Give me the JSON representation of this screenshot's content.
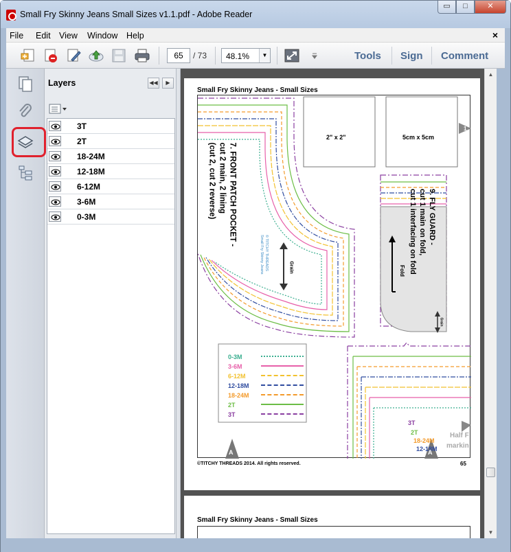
{
  "window": {
    "title": "Small Fry Skinny Jeans Small Sizes v1.1.pdf - Adobe Reader",
    "minimize": "▭",
    "maximize": "□",
    "close": "✕"
  },
  "menu": {
    "items": [
      "File",
      "Edit",
      "View",
      "Window",
      "Help"
    ],
    "close": "×"
  },
  "toolbar": {
    "page_number": "65",
    "page_total": "/ 73",
    "zoom": "48.1%",
    "zoom_arrow": "▼",
    "tools": "Tools",
    "sign": "Sign",
    "comment": "Comment",
    "icons": [
      "create-pdf-icon",
      "convert-pdf-icon",
      "edit-icon",
      "upload-icon",
      "save-icon",
      "print-icon",
      "fit-page-icon",
      "toolbar-options-icon"
    ]
  },
  "left_rail": {
    "icons": [
      "pages-icon",
      "attachments-icon",
      "layers-icon",
      "model-tree-icon"
    ],
    "active": "layers-icon",
    "highlight_color": "#e0212d"
  },
  "layers": {
    "title": "Layers",
    "collapse": "◀◀",
    "close": "▶",
    "items": [
      {
        "label": "3T"
      },
      {
        "label": "2T"
      },
      {
        "label": "18-24M"
      },
      {
        "label": "12-18M"
      },
      {
        "label": "6-12M"
      },
      {
        "label": "3-6M"
      },
      {
        "label": "0-3M"
      }
    ]
  },
  "document": {
    "page_header": "Small Fry Skinny Jeans - Small Sizes",
    "footer_left": "©TITCHY THREADS 2014. All rights reserved.",
    "footer_right": "65",
    "next_page_header": "Small Fry Skinny Jeans - Small Sizes",
    "box_2in": "2\" x 2\"",
    "box_5cm": "5cm x 5cm",
    "marker_1": "1",
    "marker_a": "A",
    "pocket_line1": "7. FRONT PATCH POCKET -",
    "pocket_line2": "cut 2 main, 2 lining",
    "pocket_line3": "(cut 2, cut 2 reverse)",
    "brand_line1": "© TITCHY THREADS",
    "brand_line2": "Small Fry Skinny Jeans",
    "grain": "Grain",
    "fly_line1": "9. FLY GUARD -",
    "fly_line2": "cut 1 main on fold,",
    "fly_line3": "cut 1 interfacing on fold",
    "fold": "Fold",
    "fly_grain": "Grain",
    "half_front": "Half F",
    "marking": "markin",
    "mini_labels": [
      "3T",
      "2T",
      "18-24M",
      "12-18M"
    ],
    "legend": [
      {
        "label": "0-3M",
        "color": "#3aae8f"
      },
      {
        "label": "3-6M",
        "color": "#e75fa9"
      },
      {
        "label": "6-12M",
        "color": "#f2c12e"
      },
      {
        "label": "12-18M",
        "color": "#2f4c9f"
      },
      {
        "label": "18-24M",
        "color": "#f39a2a"
      },
      {
        "label": "2T",
        "color": "#6cbd45"
      },
      {
        "label": "3T",
        "color": "#8a3ea0"
      }
    ]
  }
}
